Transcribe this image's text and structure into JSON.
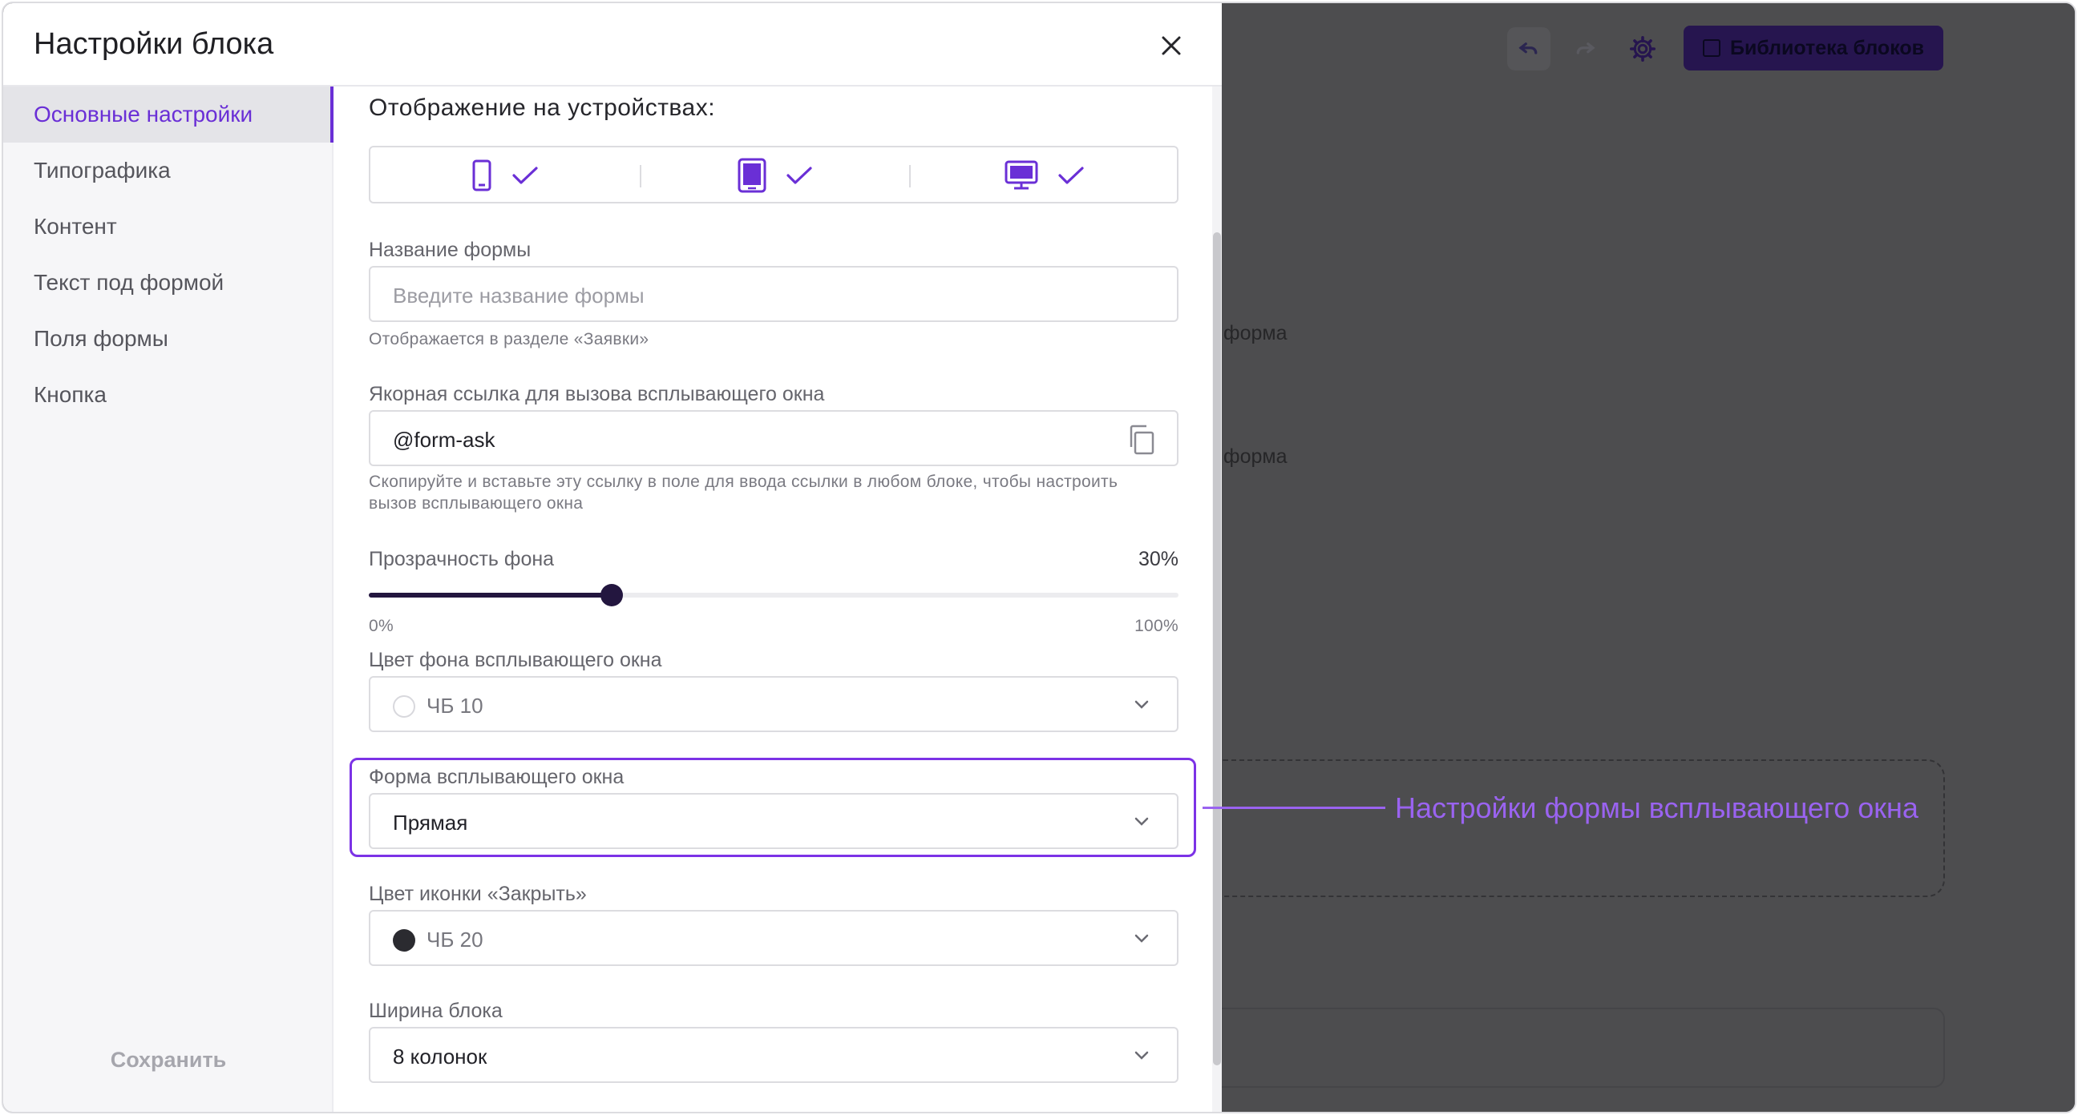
{
  "editor": {
    "library_button": "Библиотека блоков",
    "bg_text_1": "форма",
    "bg_text_2": "форма",
    "icons": [
      "undo-icon",
      "redo-icon",
      "gear-icon",
      "library-icon"
    ]
  },
  "modal": {
    "title": "Настройки блока",
    "close_icon": "close-icon"
  },
  "sidebar": {
    "items": [
      {
        "label": "Основные настройки",
        "active": true
      },
      {
        "label": "Типографика",
        "active": false
      },
      {
        "label": "Контент",
        "active": false
      },
      {
        "label": "Текст под формой",
        "active": false
      },
      {
        "label": "Поля формы",
        "active": false
      },
      {
        "label": "Кнопка",
        "active": false
      }
    ],
    "save_label": "Сохранить"
  },
  "content": {
    "devices": {
      "title": "Отображение на устройствах:",
      "items": [
        {
          "name": "mobile",
          "icon": "phone-icon",
          "checked": true
        },
        {
          "name": "tablet",
          "icon": "tablet-icon",
          "checked": true
        },
        {
          "name": "desktop",
          "icon": "desktop-icon",
          "checked": true
        }
      ]
    },
    "form_name": {
      "label": "Название формы",
      "placeholder": "Введите название формы",
      "hint": "Отображается в разделе «Заявки»"
    },
    "anchor": {
      "label": "Якорная ссылка для вызова всплывающего окна",
      "value": "@form-ask",
      "hint_line1": "Скопируйте и вставьте эту ссылку в поле для ввода ссылки в любом блоке, чтобы настроить",
      "hint_line2": "вызов всплывающего окна",
      "copy_icon": "copy-icon"
    },
    "opacity": {
      "label": "Прозрачность фона",
      "value_label": "30%",
      "value": 0.3,
      "min_label": "0%",
      "max_label": "100%"
    },
    "popup_bg_color": {
      "label": "Цвет фона всплывающего окна",
      "value": "ЧБ 10",
      "swatch": "#ffffff"
    },
    "popup_shape": {
      "label": "Форма всплывающего окна",
      "value": "Прямая"
    },
    "close_icon_color": {
      "label": "Цвет иконки «Закрыть»",
      "value": "ЧБ 20",
      "swatch": "#2b2b30"
    },
    "block_width": {
      "label": "Ширина блока",
      "value": "8 колонок"
    }
  },
  "annotation": {
    "text": "Настройки формы всплывающего окна",
    "color": "#9a63f0"
  },
  "colors": {
    "accent": "#6a2fd6",
    "dark": "#23163f"
  }
}
